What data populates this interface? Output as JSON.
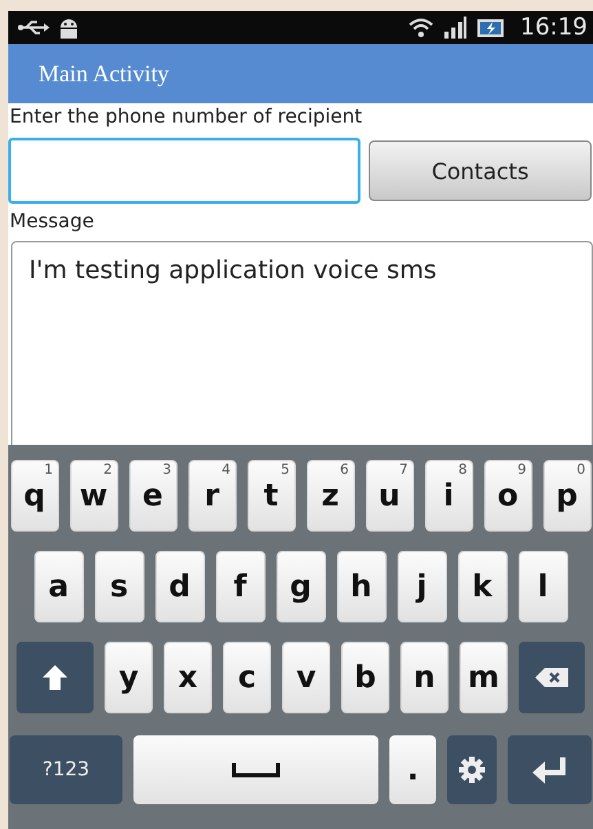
{
  "status_bar": {
    "time": "16:19"
  },
  "action_bar": {
    "title": "Main Activity"
  },
  "phone": {
    "label": "Enter the phone number of recipient",
    "focused": true
  },
  "contacts_button": {
    "label": "Contacts"
  },
  "message": {
    "label": "Message",
    "value": "I'm testing application voice sms",
    "focused": false
  },
  "keyboard": {
    "rows": [
      [
        {
          "kind": "letter",
          "label": "q",
          "hint": "1"
        },
        {
          "kind": "letter",
          "label": "w",
          "hint": "2"
        },
        {
          "kind": "letter",
          "label": "e",
          "hint": "3"
        },
        {
          "kind": "letter",
          "label": "r",
          "hint": "4"
        },
        {
          "kind": "letter",
          "label": "t",
          "hint": "5"
        },
        {
          "kind": "letter",
          "label": "z",
          "hint": "6"
        },
        {
          "kind": "letter",
          "label": "u",
          "hint": "7"
        },
        {
          "kind": "letter",
          "label": "i",
          "hint": "8"
        },
        {
          "kind": "letter",
          "label": "o",
          "hint": "9"
        },
        {
          "kind": "letter",
          "label": "p",
          "hint": "0"
        }
      ],
      [
        {
          "kind": "letter",
          "label": "a"
        },
        {
          "kind": "letter",
          "label": "s"
        },
        {
          "kind": "letter",
          "label": "d"
        },
        {
          "kind": "letter",
          "label": "f"
        },
        {
          "kind": "letter",
          "label": "g"
        },
        {
          "kind": "letter",
          "label": "h"
        },
        {
          "kind": "letter",
          "label": "j"
        },
        {
          "kind": "letter",
          "label": "k"
        },
        {
          "kind": "letter",
          "label": "l"
        }
      ],
      [
        {
          "kind": "shift"
        },
        {
          "kind": "letter",
          "label": "y"
        },
        {
          "kind": "letter",
          "label": "x"
        },
        {
          "kind": "letter",
          "label": "c"
        },
        {
          "kind": "letter",
          "label": "v"
        },
        {
          "kind": "letter",
          "label": "b"
        },
        {
          "kind": "letter",
          "label": "n"
        },
        {
          "kind": "letter",
          "label": "m"
        },
        {
          "kind": "backspace"
        }
      ],
      [
        {
          "kind": "symbols",
          "label": "?123"
        },
        {
          "kind": "space"
        },
        {
          "kind": "period",
          "label": "."
        },
        {
          "kind": "settings"
        },
        {
          "kind": "enter"
        }
      ]
    ]
  }
}
